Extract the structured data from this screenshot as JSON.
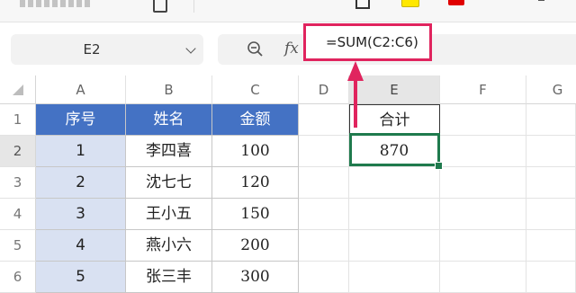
{
  "formula_bar": {
    "name_box": "E2",
    "formula": "=SUM(C2:C6)",
    "fx_label": "fx"
  },
  "columns": [
    "A",
    "B",
    "C",
    "D",
    "E",
    "F",
    "G"
  ],
  "rows": [
    "1",
    "2",
    "3",
    "4",
    "5",
    "6"
  ],
  "table": {
    "headers": [
      "序号",
      "姓名",
      "金额"
    ],
    "rows": [
      [
        "1",
        "李四喜",
        "100"
      ],
      [
        "2",
        "沈七七",
        "120"
      ],
      [
        "3",
        "王小五",
        "150"
      ],
      [
        "4",
        "燕小六",
        "200"
      ],
      [
        "5",
        "张三丰",
        "300"
      ]
    ]
  },
  "summary": {
    "label": "合计",
    "value": "870"
  },
  "colors": {
    "table_header": "#4472c4",
    "index_column": "#d9e1f2",
    "highlight": "#e0245e",
    "active_cell": "#1f7a4d"
  }
}
